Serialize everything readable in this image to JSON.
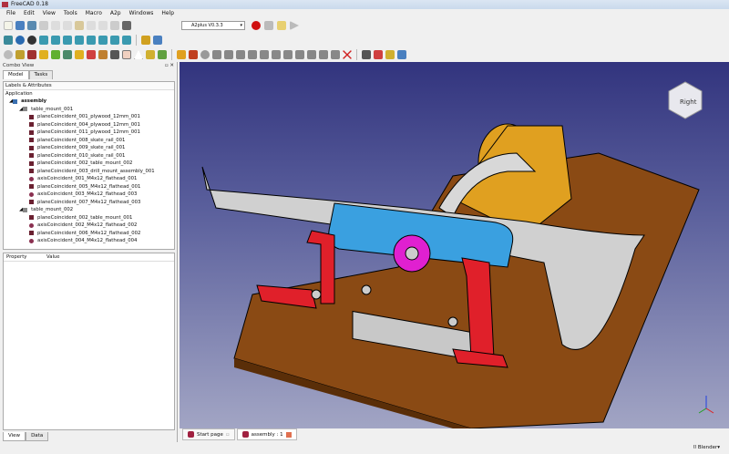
{
  "window": {
    "title": "FreeCAD 0.18"
  },
  "menu": [
    "File",
    "Edit",
    "View",
    "Tools",
    "Macro",
    "A2p",
    "Windows",
    "Help"
  ],
  "workbench": {
    "selected": "A2plus V0.3.3"
  },
  "combo_view": {
    "title": "Combo View",
    "tabs": [
      "Model",
      "Tasks"
    ],
    "section": "Labels & Attributes",
    "root": "Application"
  },
  "tree": [
    {
      "label": "assembly",
      "level": 0,
      "type": "doc"
    },
    {
      "label": "table_mount_001",
      "level": 1,
      "type": "part"
    },
    {
      "label": "planeCoincident_001_plywood_12mm_001",
      "level": 2,
      "type": "plane"
    },
    {
      "label": "planeCoincident_004_plywood_12mm_001",
      "level": 2,
      "type": "plane"
    },
    {
      "label": "planeCoincident_011_plywood_12mm_001",
      "level": 2,
      "type": "plane"
    },
    {
      "label": "planeCoincident_008_skate_rail_001",
      "level": 2,
      "type": "plane"
    },
    {
      "label": "planeCoincident_009_skate_rail_001",
      "level": 2,
      "type": "plane"
    },
    {
      "label": "planeCoincident_010_skate_rail_001",
      "level": 2,
      "type": "plane"
    },
    {
      "label": "planeCoincident_002_table_mount_002",
      "level": 2,
      "type": "plane"
    },
    {
      "label": "planeCoincident_003_drill_mount_assembly_001",
      "level": 2,
      "type": "plane"
    },
    {
      "label": "axisCoincident_001_M4x12_flathead_001",
      "level": 2,
      "type": "axis"
    },
    {
      "label": "planeCoincident_005_M4x12_flathead_001",
      "level": 2,
      "type": "plane"
    },
    {
      "label": "axisCoincident_003_M4x12_flathead_003",
      "level": 2,
      "type": "axis"
    },
    {
      "label": "planeCoincident_007_M4x12_flathead_003",
      "level": 2,
      "type": "plane"
    },
    {
      "label": "table_mount_002",
      "level": 1,
      "type": "part"
    },
    {
      "label": "planeCoincident_002_table_mount_001",
      "level": 2,
      "type": "plane"
    },
    {
      "label": "axisCoincident_002_M4x12_flathead_002",
      "level": 2,
      "type": "axis"
    },
    {
      "label": "planeCoincident_006_M4x12_flathead_002",
      "level": 2,
      "type": "plane"
    },
    {
      "label": "axisCoincident_004_M4x12_flathead_004",
      "level": 2,
      "type": "axis"
    }
  ],
  "property": {
    "col1": "Property",
    "col2": "Value"
  },
  "bottom_tabs": [
    "View",
    "Data"
  ],
  "nav_cube": {
    "face": "Right"
  },
  "doc_tabs": [
    "Start page",
    "assembly : 1"
  ],
  "status": {
    "nav_style": "Blender"
  },
  "colors": {
    "viewport_top": "#32347e",
    "viewport_bottom": "#a2a5c4",
    "base": "#8a4a14",
    "red": "#e0202a",
    "blue": "#3aa0e0",
    "magenta": "#e020d0",
    "yellow": "#e0a020"
  }
}
